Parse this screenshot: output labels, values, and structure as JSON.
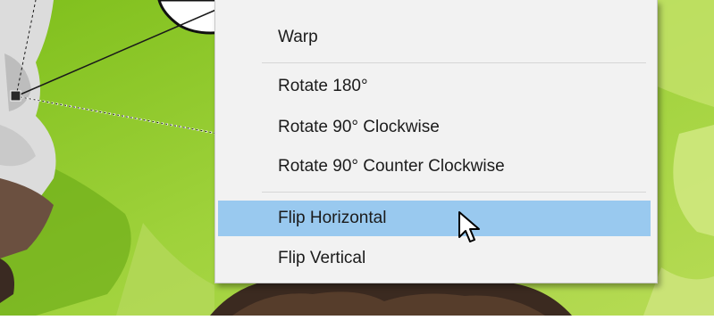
{
  "menu": {
    "items": [
      {
        "label": "Warp",
        "highlighted": false
      },
      {
        "label": "Rotate 180°",
        "highlighted": false
      },
      {
        "label": "Rotate 90° Clockwise",
        "highlighted": false
      },
      {
        "label": "Rotate 90° Counter Clockwise",
        "highlighted": false
      },
      {
        "label": "Flip Horizontal",
        "highlighted": true
      },
      {
        "label": "Flip Vertical",
        "highlighted": false
      }
    ]
  },
  "colors": {
    "highlight": "#99c9ef",
    "menu_background": "#f2f2f2",
    "canvas_green": "#8fc929",
    "transform_handle": "#2a2a2a"
  },
  "icons": [
    "mouse-pointer-icon"
  ]
}
